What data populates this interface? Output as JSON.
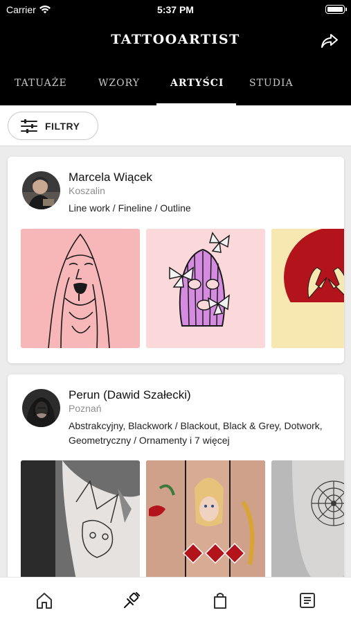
{
  "status_bar": {
    "carrier": "Carrier",
    "time": "5:37 PM"
  },
  "header": {
    "title": "TATTOOARTIST"
  },
  "tabs": [
    {
      "label": "TATUAŻE",
      "active": false
    },
    {
      "label": "WZORY",
      "active": false
    },
    {
      "label": "ARTYŚCI",
      "active": true
    },
    {
      "label": "STUDIA",
      "active": false
    }
  ],
  "filter": {
    "label": "FILTRY"
  },
  "artists": [
    {
      "name": "Marcela Wiącek",
      "city": "Koszalin",
      "styles": "Line work / Fineline / Outline"
    },
    {
      "name": "Perun  (Dawid Szałecki)",
      "city": "Poznań",
      "styles": "Abstrakcyjny, Blackwork / Blackout, Black & Grey, Dotwork, Geometryczny / Ornamenty i 7 więcej"
    }
  ],
  "bottom_nav": [
    {
      "icon": "home-icon"
    },
    {
      "icon": "tattoo-machine-icon"
    },
    {
      "icon": "shopping-bag-icon"
    },
    {
      "icon": "list-icon"
    }
  ],
  "colors": {
    "header_bg": "#000000",
    "card_bg": "#ffffff",
    "pink_tile": "#f7b6b8",
    "light_pink_tile": "#fbd8da",
    "yellow_tile": "#f7e7b0",
    "accent_red": "#b3141b"
  }
}
